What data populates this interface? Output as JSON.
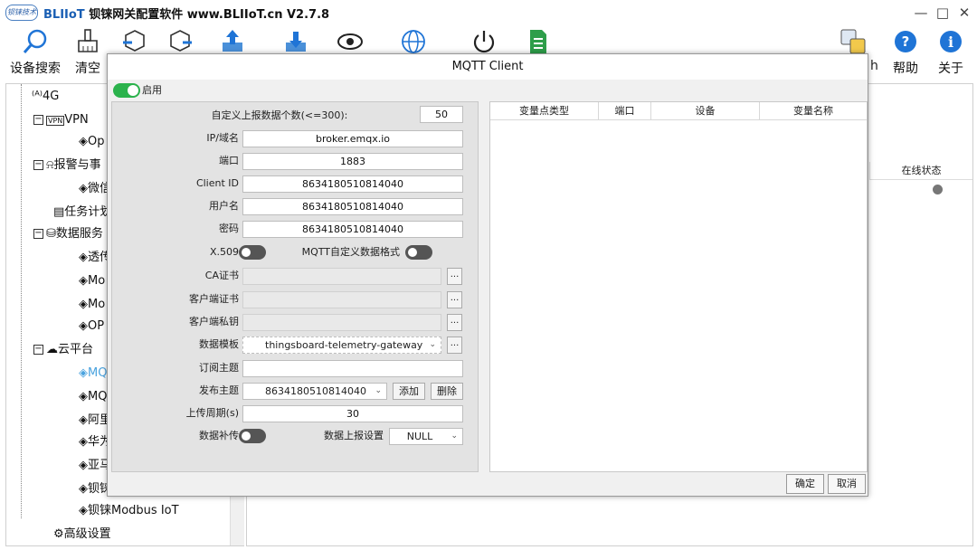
{
  "window": {
    "logo_text": "钡铼技术",
    "title_brand": "BLIIoT",
    "title_rest": " 钡铼网关配置软件 www.BLIIoT.cn V2.7.8",
    "minimize": "—",
    "maximize": "□",
    "close": "✕"
  },
  "toolbar": {
    "search_label": "设备搜索",
    "clear_label": "清空",
    "refresh_partial_label": "h",
    "help_label": "帮助",
    "about_label": "关于"
  },
  "tree": {
    "items": [
      {
        "label": "4G"
      },
      {
        "label": "VPN"
      },
      {
        "label": "Op"
      },
      {
        "label": "报警与事"
      },
      {
        "label": "微信"
      },
      {
        "label": "任务计划"
      },
      {
        "label": "数据服务"
      },
      {
        "label": "透传"
      },
      {
        "label": "Mo"
      },
      {
        "label": "Mo"
      },
      {
        "label": "OP"
      },
      {
        "label": "云平台"
      },
      {
        "label": "MQ"
      },
      {
        "label": "MQ"
      },
      {
        "label": "阿里"
      },
      {
        "label": "华为"
      },
      {
        "label": "亚马"
      },
      {
        "label": "钡铼"
      },
      {
        "label": "钡铼Modbus IoT"
      },
      {
        "label": "高级设置"
      }
    ]
  },
  "background": {
    "online_status_header": "在线状态"
  },
  "dialog": {
    "title": "MQTT Client",
    "enable_label": "启用",
    "fields": {
      "custom_count_label": "自定义上报数据个数(<=300):",
      "custom_count_value": "50",
      "host_label": "IP/域名",
      "host_value": "broker.emqx.io",
      "port_label": "端口",
      "port_value": "1883",
      "client_id_label": "Client ID",
      "client_id_value": "8634180510814040",
      "username_label": "用户名",
      "username_value": "8634180510814040",
      "password_label": "密码",
      "password_value": "8634180510814040",
      "x509_label": "X.509",
      "custom_format_label": "MQTT自定义数据格式",
      "ca_label": "CA证书",
      "client_cert_label": "客户端证书",
      "client_key_label": "客户端私钥",
      "template_label": "数据模板",
      "template_value": "thingsboard-telemetry-gateway",
      "subscribe_label": "订阅主题",
      "subscribe_value": "",
      "publish_label": "发布主题",
      "publish_value": "8634180510814040",
      "add_label": "添加",
      "delete_label": "删除",
      "period_label": "上传周期(s)",
      "period_value": "30",
      "resend_label": "数据补传",
      "report_setting_label": "数据上报设置",
      "report_setting_value": "NULL",
      "browse_label": "..."
    },
    "table_headers": [
      "变量点类型",
      "端口",
      "设备",
      "变量名称"
    ],
    "ok_label": "确定",
    "cancel_label": "取消"
  }
}
